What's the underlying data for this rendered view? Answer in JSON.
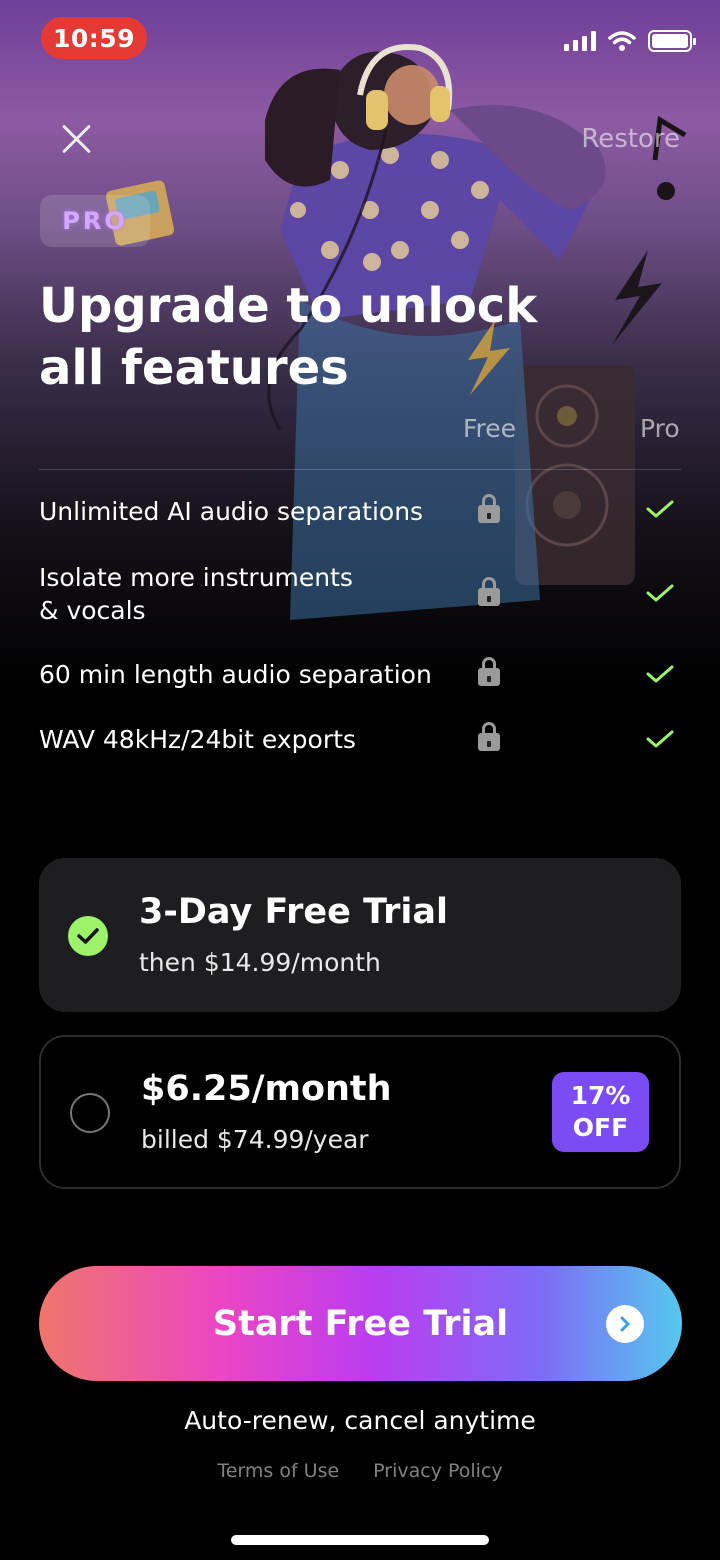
{
  "status_bar": {
    "time": "10:59",
    "icons": [
      "signal-icon",
      "wifi-icon",
      "battery-icon"
    ]
  },
  "header": {
    "close_icon": "close-icon",
    "restore_label": "Restore",
    "pro_badge": "PRO"
  },
  "headline": "Upgrade to unlock all features",
  "comparison": {
    "col_free": "Free",
    "col_pro": "Pro",
    "features": [
      {
        "label": "Unlimited AI audio separations",
        "free": "lock-icon",
        "pro": "check-icon"
      },
      {
        "label": "Isolate more instruments & vocals",
        "free": "lock-icon",
        "pro": "check-icon"
      },
      {
        "label": "60 min length audio separation",
        "free": "lock-icon",
        "pro": "check-icon"
      },
      {
        "label": "WAV 48kHz/24bit exports",
        "free": "lock-icon",
        "pro": "check-icon"
      }
    ]
  },
  "plans": [
    {
      "title": "3-Day Free Trial",
      "subtitle": "then $14.99/month",
      "selected": true
    },
    {
      "title": "$6.25/month",
      "subtitle": "billed $74.99/year",
      "selected": false,
      "badge_line1": "17%",
      "badge_line2": "OFF"
    }
  ],
  "cta": {
    "label": "Start Free Trial",
    "icon": "chevron-right-icon"
  },
  "footer": {
    "auto_renew": "Auto-renew, cancel anytime",
    "terms": "Terms of Use",
    "privacy": "Privacy Policy"
  },
  "colors": {
    "accent_green": "#9cf36a",
    "badge_purple": "#7b4cf4",
    "status_red": "#e53935"
  }
}
